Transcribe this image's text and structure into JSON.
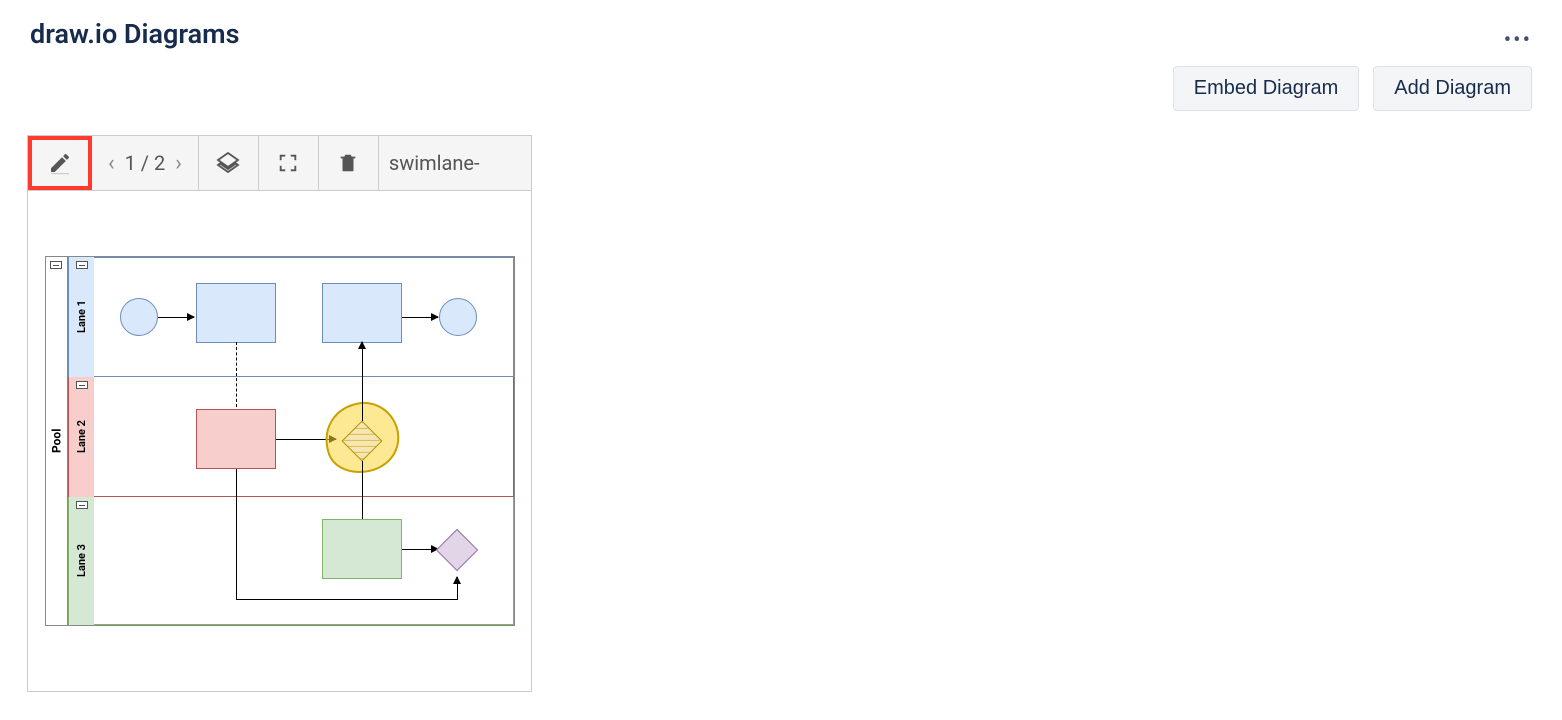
{
  "header": {
    "title": "draw.io Diagrams"
  },
  "actions": {
    "embed": "Embed Diagram",
    "add": "Add Diagram"
  },
  "toolbar": {
    "page_indicator": "1 / 2",
    "filename": "swimlane-"
  },
  "swimlane": {
    "pool_label": "Pool",
    "lanes": [
      {
        "label": "Lane 1"
      },
      {
        "label": "Lane 2"
      },
      {
        "label": "Lane 3"
      }
    ]
  }
}
